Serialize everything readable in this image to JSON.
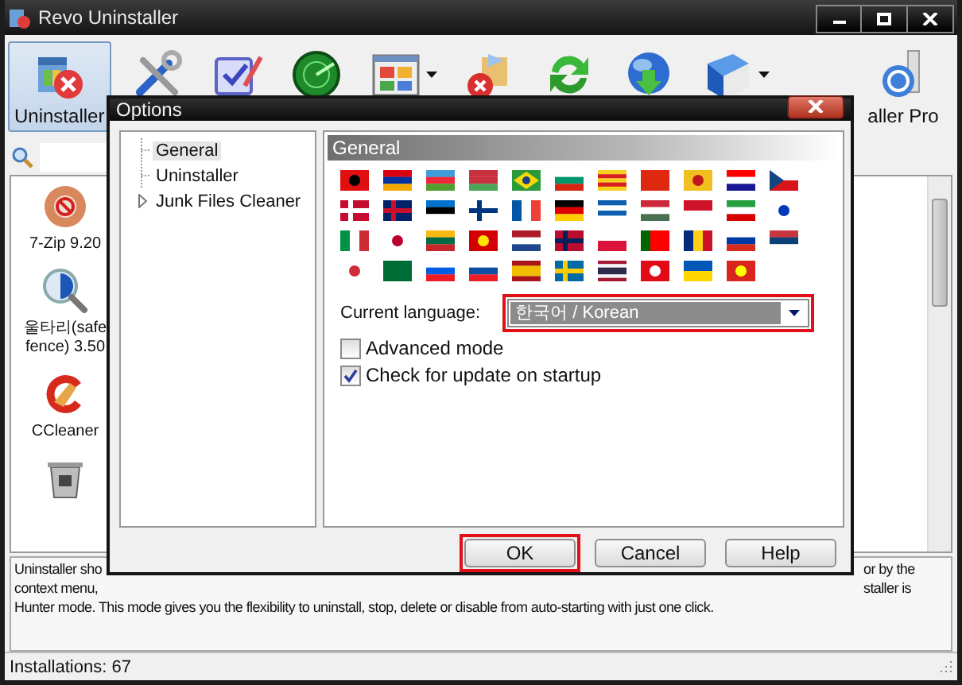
{
  "window": {
    "title": "Revo Uninstaller"
  },
  "toolbar": [
    {
      "kind": "uninstaller",
      "label": "Uninstaller",
      "selected": true
    },
    {
      "kind": "tools",
      "selected": false
    },
    {
      "kind": "checklist",
      "selected": false
    },
    {
      "kind": "radar",
      "selected": false
    },
    {
      "kind": "grid",
      "selected": false,
      "has_menu": true
    },
    {
      "kind": "box",
      "selected": false
    },
    {
      "kind": "refresh",
      "selected": false
    },
    {
      "kind": "globe",
      "selected": false
    },
    {
      "kind": "book",
      "selected": false,
      "has_menu": true
    },
    {
      "kind": "pro",
      "label": "aller Pro",
      "selected": false
    }
  ],
  "programs": [
    {
      "kind": "zip",
      "label_lines": [
        "7-Zip 9.20"
      ]
    },
    {
      "kind": "magnifier",
      "label_lines": [
        "울타리(safe",
        "fence) 3.50"
      ]
    },
    {
      "kind": "ccleaner",
      "label_lines": [
        "CCleaner"
      ]
    },
    {
      "kind": "trash"
    }
  ],
  "description": {
    "lines": [
      {
        "left": "Uninstaller sho",
        "right": "or by the"
      },
      {
        "left": "context menu,",
        "right": "staller is"
      },
      {
        "left": "Hunter mode. This mode gives you the flexibility to uninstall, stop, delete or disable from auto-starting with just one click."
      }
    ]
  },
  "status_bar": "Installations: 67",
  "options_dialog": {
    "title": "Options",
    "tree": [
      {
        "label": "General",
        "selected": true
      },
      {
        "label": "Uninstaller",
        "selected": false
      },
      {
        "label": "Junk Files Cleaner",
        "selected": false,
        "expanded": false
      }
    ],
    "section_title": "General",
    "language": {
      "label": "Current language:",
      "value": "한국어 / Korean",
      "highlighted": true
    },
    "checkboxes": [
      {
        "label": "Advanced mode",
        "checked": false
      },
      {
        "label": "Check for update on startup",
        "checked": true
      }
    ],
    "buttons": [
      {
        "label": "OK",
        "highlighted": true
      },
      {
        "label": "Cancel",
        "highlighted": false
      },
      {
        "label": "Help",
        "highlighted": false
      }
    ]
  }
}
